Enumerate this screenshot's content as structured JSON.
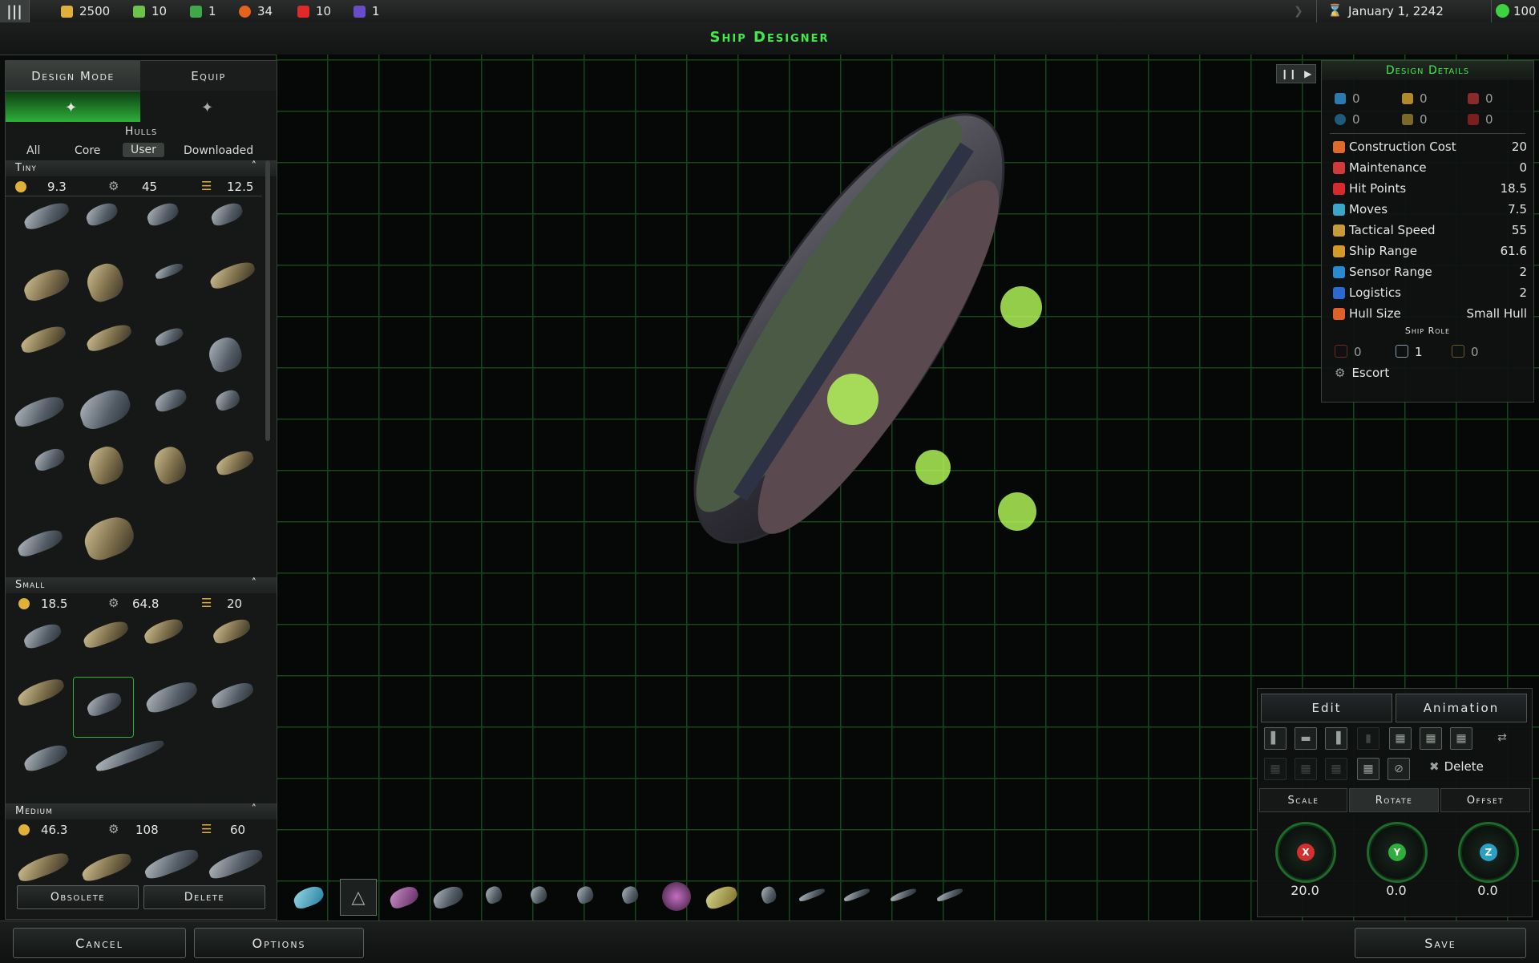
{
  "topbar": {
    "menu_icon": "menu-icon",
    "resources": [
      {
        "name": "credits",
        "value": "2500",
        "color": "#e0b13a"
      },
      {
        "name": "manufacturing",
        "value": "10",
        "color": "#6cc24a"
      },
      {
        "name": "food",
        "value": "1",
        "color": "#3fa84a"
      },
      {
        "name": "research",
        "value": "34",
        "color": "#e5631f"
      },
      {
        "name": "influence",
        "value": "10",
        "color": "#e02a2a"
      },
      {
        "name": "elerium",
        "value": "1",
        "color": "#6a4cc9"
      }
    ],
    "date": "January 1, 2242",
    "approval": "100"
  },
  "title": "Ship Designer",
  "left_panel": {
    "tabs": [
      "Design Mode",
      "Equip"
    ],
    "section_title": "Hulls",
    "filters": [
      "All",
      "Core",
      "User",
      "Downloaded"
    ],
    "active_filter": "User",
    "groups": [
      {
        "name": "Tiny",
        "cost": "9.3",
        "hp": "45",
        "capacity": "12.5"
      },
      {
        "name": "Small",
        "cost": "18.5",
        "hp": "64.8",
        "capacity": "20"
      },
      {
        "name": "Medium",
        "cost": "46.3",
        "hp": "108",
        "capacity": "60"
      }
    ],
    "buttons": {
      "obsolete": "Obsolete",
      "delete": "Delete"
    }
  },
  "details": {
    "title": "Design Details",
    "weapon_stats": [
      "0",
      "0",
      "0",
      "0",
      "0",
      "0"
    ],
    "rows": [
      {
        "label": "Construction Cost",
        "value": "20",
        "color": "#e06a2a"
      },
      {
        "label": "Maintenance",
        "value": "0",
        "color": "#d23a3a"
      },
      {
        "label": "Hit Points",
        "value": "18.5",
        "color": "#d82a2a"
      },
      {
        "label": "Moves",
        "value": "7.5",
        "color": "#3aa6c8"
      },
      {
        "label": "Tactical Speed",
        "value": "55",
        "color": "#c79a3a"
      },
      {
        "label": "Ship Range",
        "value": "61.6",
        "color": "#d39a2a"
      },
      {
        "label": "Sensor Range",
        "value": "2",
        "color": "#2a8ad0"
      },
      {
        "label": "Logistics",
        "value": "2",
        "color": "#2a6ad0"
      },
      {
        "label": "Hull Size",
        "value": "Small Hull",
        "color": "#e0602a"
      }
    ],
    "ship_role_title": "Ship Role",
    "role_counts": [
      "0",
      "1",
      "0"
    ],
    "role": "Escort"
  },
  "edit_panel": {
    "tabs": [
      "Edit",
      "Animation"
    ],
    "delete_label": "Delete",
    "subtabs": [
      "Scale",
      "Rotate",
      "Offset"
    ],
    "active_subtab": "Rotate",
    "dials": [
      {
        "axis": "X",
        "value": "20.0",
        "color": "#d23030"
      },
      {
        "axis": "Y",
        "value": "0.0",
        "color": "#2fae3a"
      },
      {
        "axis": "Z",
        "value": "0.0",
        "color": "#2aa0c8"
      }
    ]
  },
  "bottom": {
    "cancel": "Cancel",
    "options": "Options",
    "save": "Save"
  }
}
